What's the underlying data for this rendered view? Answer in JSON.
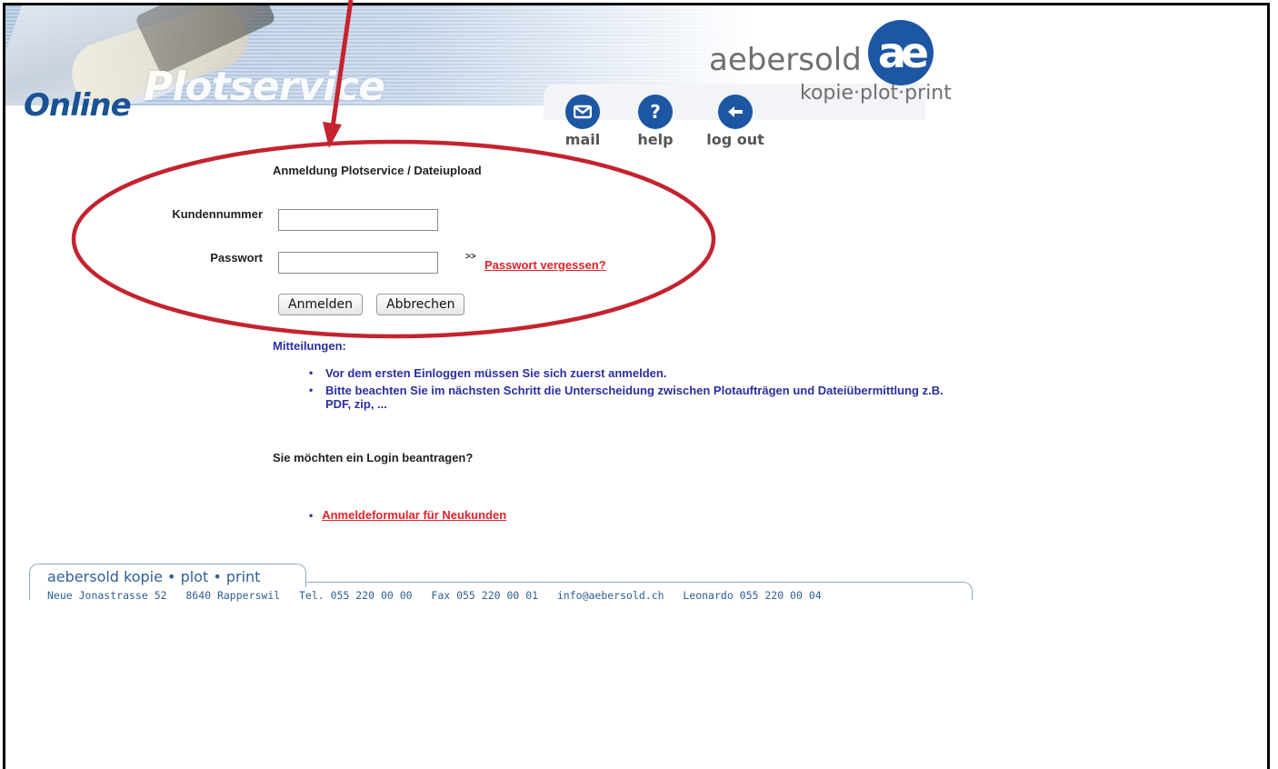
{
  "header": {
    "brand_online": "Online",
    "brand_plot": "Plotservice",
    "logo_name": "aebersold",
    "logo_mark": "ae",
    "logo_tagline": "kopie·plot·print",
    "nav": [
      {
        "label": "mail",
        "icon": "mail-icon"
      },
      {
        "label": "help",
        "icon": "help-icon"
      },
      {
        "label": "log out",
        "icon": "logout-icon"
      }
    ]
  },
  "login": {
    "title": "Anmeldung Plotservice / Dateiupload",
    "customer_label": "Kundennummer",
    "customer_value": "",
    "password_label": "Passwort",
    "password_value": "",
    "forgot_prefix": ">>",
    "forgot_link": "Passwort vergessen?",
    "login_button": "Anmelden",
    "cancel_button": "Abbrechen"
  },
  "messages": {
    "heading": "Mitteilungen:",
    "items": [
      "Vor dem ersten Einloggen müssen Sie sich zuerst anmelden.",
      "Bitte beachten Sie im nächsten Schritt die Unterscheidung zwischen Plotaufträgen und Dateiübermittlung z.B. PDF, zip, ..."
    ]
  },
  "register": {
    "question": "Sie möchten ein Login beantragen?",
    "link": "Anmeldeformular für Neukunden"
  },
  "footer": {
    "brand": "aebersold kopie • plot • print",
    "address": "Neue Jonastrasse 52",
    "city": "8640 Rapperswil",
    "tel": "Tel. 055 220 00 00",
    "fax": "Fax 055 220 00 01",
    "email": "info@aebersold.ch",
    "leonardo": "Leonardo 055 220 00 04"
  },
  "colors": {
    "annotation": "#c4232f",
    "brand_blue": "#1d56a3",
    "link_red": "#e0232a",
    "message_blue": "#2a2fa0"
  }
}
